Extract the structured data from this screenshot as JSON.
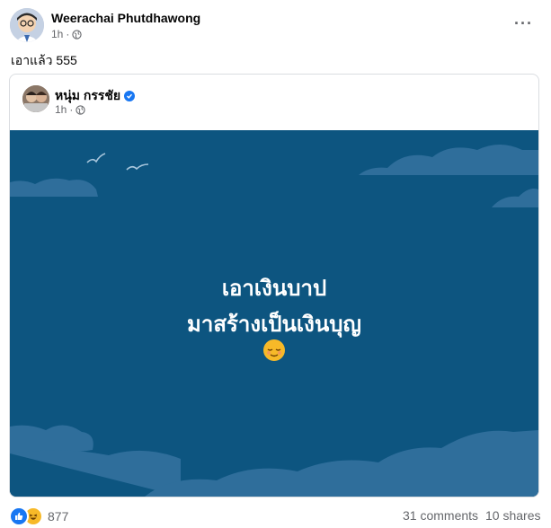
{
  "author": {
    "name": "Weerachai Phutdhawong",
    "time": "1h"
  },
  "post": {
    "text": "เอาแล้ว 555"
  },
  "shared": {
    "name": "หนุ่ม กรรชัย",
    "time": "1h",
    "image_text_line1": "เอาเงินบาป",
    "image_text_line2": "มาสร้างเป็นเงินบุญ",
    "emoji": "relieved-face-emoji"
  },
  "footer": {
    "reaction_count": "877",
    "comments": "31 comments",
    "shares": "10 shares"
  },
  "icons": [
    "globe-icon",
    "more-icon",
    "verified-icon",
    "like-icon",
    "haha-icon"
  ],
  "colors": {
    "image_bg": "#0d5580",
    "cloud": "#2f6e9b",
    "link": "#1877f2",
    "muted": "#65676b"
  }
}
